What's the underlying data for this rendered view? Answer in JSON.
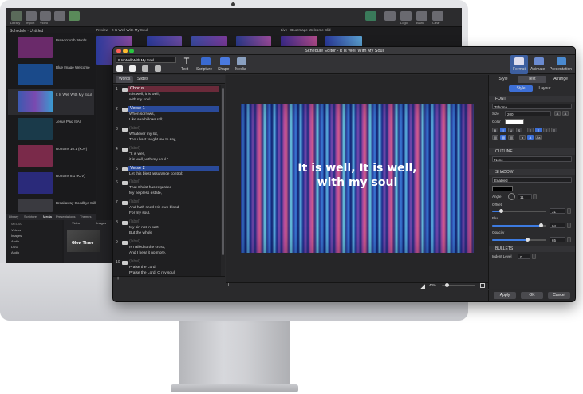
{
  "background_app": {
    "schedule_header": "Schedule · Untitled",
    "preview_header": "Preview · It Is Well With My Soul",
    "live_header": "Live · BlueImage Welcome Slid",
    "toolbar_labels": [
      "Library",
      "Import",
      "Video",
      "Logo",
      "Blank",
      "Clear"
    ],
    "schedule_items": [
      {
        "title": "Breadcrumb Words",
        "thumb": "#6a2a6a"
      },
      {
        "title": "Blue Image Welcome",
        "thumb": "#1a4a8a"
      },
      {
        "title": "It Is Well With My Soul",
        "thumb": "#4a4aa0"
      },
      {
        "title": "Jesus Paid It All",
        "thumb": "#1a3a4a"
      },
      {
        "title": "Romans 10:1 (KJV)",
        "thumb": "#7a2a4a"
      },
      {
        "title": "Romans 8:1 (KJV)",
        "thumb": "#2a2a7a"
      },
      {
        "title": "Breakaway Goodbye Still",
        "thumb": "#3a3a40"
      }
    ],
    "library_tabs": [
      "Library",
      "Scripture",
      "Media",
      "Presentations",
      "Themes"
    ],
    "media_tree": [
      "MEDIA",
      "Videos",
      "Images",
      "Audio",
      "DVD",
      "Audio"
    ],
    "bottom_tabs": [
      "Video",
      "Images"
    ],
    "bottom_item": "Glow Three"
  },
  "window": {
    "title": "Schedule Editor - It Is Well With My Soul",
    "name_field": "It Is Well With My Soul"
  },
  "toolbar": {
    "items": [
      {
        "label": "Text",
        "icon": "text-icon"
      },
      {
        "label": "Scripture",
        "icon": "scripture-icon"
      },
      {
        "label": "Shape",
        "icon": "shape-icon"
      },
      {
        "label": "Media",
        "icon": "media-icon"
      }
    ],
    "right_items": [
      {
        "label": "Format",
        "icon": "format-icon"
      },
      {
        "label": "Animate",
        "icon": "animate-icon"
      },
      {
        "label": "Presentation",
        "icon": "presentation-icon"
      }
    ]
  },
  "left_panel": {
    "tabs": [
      "Words",
      "Slides"
    ],
    "slides": [
      {
        "num": "1",
        "label": "Chorus",
        "highlight": "#6a2a3a",
        "lines": [
          "It is well, it is well,",
          "with my soul"
        ]
      },
      {
        "num": "2",
        "label": "Verse 1",
        "highlight": "#2a4a9a",
        "lines": [
          "When sorrows,",
          "Like sea billows roll;"
        ]
      },
      {
        "num": "3",
        "label": "(label)",
        "highlight": "",
        "lines": [
          "Whatever my lot,",
          "Thou hast taught me to say,"
        ]
      },
      {
        "num": "4",
        "label": "(label)",
        "highlight": "",
        "lines": [
          "\"It is well,",
          "it is well, with my soul.\""
        ]
      },
      {
        "num": "5",
        "label": "Verse 2",
        "highlight": "#2a4a9a",
        "lines": [
          "Let this blest assurance control:"
        ]
      },
      {
        "num": "6",
        "label": "(label)",
        "highlight": "",
        "lines": [
          "That Christ has regarded",
          "My helpless estate,"
        ]
      },
      {
        "num": "7",
        "label": "(label)",
        "highlight": "",
        "lines": [
          "And hath shed His own blood",
          "For my soul."
        ]
      },
      {
        "num": "8",
        "label": "(label)",
        "highlight": "",
        "lines": [
          "My sin not in part",
          "But the whole"
        ]
      },
      {
        "num": "9",
        "label": "(label)",
        "highlight": "",
        "lines": [
          "Is nailed to the cross,",
          "And I bear it no more."
        ]
      },
      {
        "num": "10",
        "label": "(label)",
        "highlight": "",
        "lines": [
          "Praise the Lord,",
          "Praise the Lord, O my soul!"
        ]
      },
      {
        "num": "11",
        "label": "Verse 4",
        "highlight": "#2a4a9a",
        "lines": []
      }
    ]
  },
  "canvas": {
    "slide_text_line1": "It is well, It is well,",
    "slide_text_line2": "with my soul",
    "zoom": "40%"
  },
  "inspector": {
    "tabs": [
      "Style",
      "Text",
      "Arrange"
    ],
    "active_tab": "Text",
    "subtabs": [
      "Style",
      "Layout"
    ],
    "font": {
      "section": "FONT",
      "family": "Tahoma",
      "size_label": "Size",
      "size": "200",
      "color_label": "Color",
      "color": "#ffffff"
    },
    "outline": {
      "section": "OUTLINE",
      "value": "None"
    },
    "shadow": {
      "section": "SHADOW",
      "value": "Enabled",
      "angle_label": "Angle",
      "angle": "11",
      "offset_label": "Offset",
      "offset": "31",
      "offset_fraction": 0.17,
      "blur_label": "Blur",
      "blur": "94",
      "blur_fraction": 0.9,
      "opacity_label": "Opacity",
      "opacity": "65",
      "opacity_fraction": 0.65,
      "shadow_color": "#000000"
    },
    "bullets": {
      "section": "BULLETS",
      "indent_label": "Indent Level",
      "indent": "0"
    },
    "buttons": [
      "Apply",
      "OK",
      "Cancel"
    ]
  },
  "colors": {
    "accent": "#3d6fd6",
    "close": "#ff5f57",
    "minimize": "#febc2e",
    "zoom": "#28c840"
  }
}
